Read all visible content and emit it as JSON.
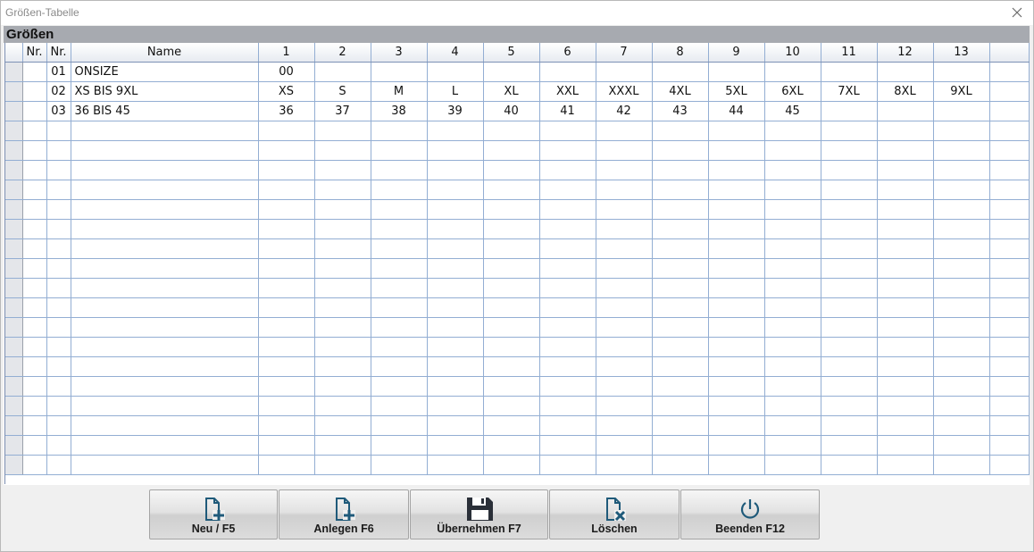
{
  "window": {
    "title": "Größen-Tabelle"
  },
  "panel": {
    "title": "Größen"
  },
  "table": {
    "headers": [
      "",
      "Nr.",
      "Nr.",
      "Name",
      "1",
      "2",
      "3",
      "4",
      "5",
      "6",
      "7",
      "8",
      "9",
      "10",
      "11",
      "12",
      "13",
      ""
    ],
    "rows": [
      {
        "nr": "01",
        "name": "ONSIZE",
        "values": [
          "00",
          "",
          "",
          "",
          "",
          "",
          "",
          "",
          "",
          "",
          "",
          "",
          ""
        ]
      },
      {
        "nr": "02",
        "name": "XS BIS 9XL",
        "values": [
          "XS",
          "S",
          "M",
          "L",
          "XL",
          "XXL",
          "XXXL",
          "4XL",
          "5XL",
          "6XL",
          "7XL",
          "8XL",
          "9XL"
        ]
      },
      {
        "nr": "03",
        "name": "36 BIS 45",
        "values": [
          "36",
          "37",
          "38",
          "39",
          "40",
          "41",
          "42",
          "43",
          "44",
          "45",
          "",
          "",
          ""
        ]
      }
    ]
  },
  "buttons": {
    "new": {
      "label": "Neu / F5",
      "icon": "new-document-icon"
    },
    "create": {
      "label": "Anlegen F6",
      "icon": "add-document-icon"
    },
    "save": {
      "label": "Übernehmen F7",
      "icon": "save-icon"
    },
    "delete": {
      "label": "Löschen",
      "icon": "delete-document-icon"
    },
    "exit": {
      "label": "Beenden F12",
      "icon": "power-icon"
    }
  },
  "colors": {
    "accent": "#1f5a7a",
    "header_bar": "#a7aab0",
    "grid_line": "#93aed3"
  }
}
